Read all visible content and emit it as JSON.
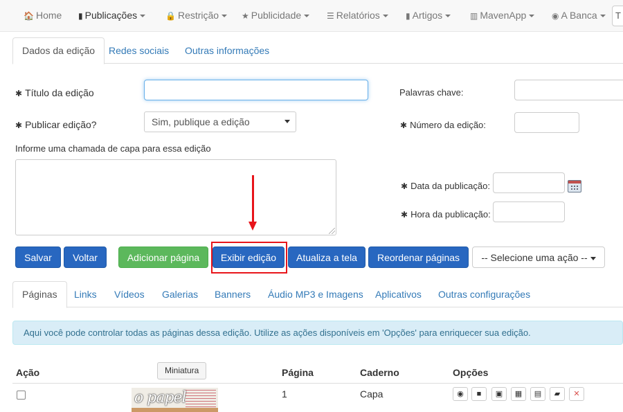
{
  "navbar": {
    "items": [
      {
        "label": "Home",
        "icon": "home-icon",
        "glyph": "🏠",
        "dropdown": false
      },
      {
        "label": "Publicações",
        "icon": "file-icon",
        "glyph": "▮",
        "dropdown": true
      },
      {
        "label": "Restrição",
        "icon": "lock-icon",
        "glyph": "🔒",
        "dropdown": true
      },
      {
        "label": "Publicidade",
        "icon": "star-icon",
        "glyph": "★",
        "dropdown": true
      },
      {
        "label": "Relatórios",
        "icon": "list-icon",
        "glyph": "☰",
        "dropdown": true
      },
      {
        "label": "Artigos",
        "icon": "bookmark-icon",
        "glyph": "▮",
        "dropdown": true
      },
      {
        "label": "MavenApp",
        "icon": "barcode-icon",
        "glyph": "▥",
        "dropdown": true
      },
      {
        "label": "A Banca",
        "icon": "globe-icon",
        "glyph": "◉",
        "dropdown": true
      }
    ],
    "end_partial": "T"
  },
  "top_tabs": [
    "Dados da edição",
    "Redes sociais",
    "Outras informações"
  ],
  "form": {
    "required_mark": "✱",
    "titulo_label": "Título da edição",
    "titulo_value": "",
    "publicar_label": "Publicar edição?",
    "publicar_value": "Sim, publique a edição",
    "chamada_label": "Informe uma chamada de capa para essa edição",
    "palavras_label": "Palavras chave:",
    "numero_label": "Número da edição:",
    "data_label": "Data da publicação:",
    "hora_label": "Hora da publicação:"
  },
  "actions": {
    "salvar": "Salvar",
    "voltar": "Voltar",
    "adicionar": "Adicionar página",
    "exibir": "Exibir edição",
    "atualiza": "Atualiza a tela",
    "reordenar": "Reordenar páginas",
    "acao_select": "-- Selecione uma ação --"
  },
  "sub_tabs": [
    "Páginas",
    "Links",
    "Vídeos",
    "Galerias",
    "Banners",
    "Áudio MP3 e Imagens",
    "Aplicativos",
    "Outras configurações"
  ],
  "alert": "Aqui você pode controlar todas as páginas dessa edição. Utilize as ações disponíveis em 'Opções' para enriquecer sua edição.",
  "table": {
    "headers": {
      "acao": "Ação",
      "miniatura": "Miniatura",
      "pagina": "Página",
      "caderno": "Caderno",
      "opcoes": "Opções"
    },
    "rows": [
      {
        "pagina": "1",
        "caderno": "Capa",
        "thumb_logo": "o papel"
      }
    ],
    "option_icons": [
      {
        "icon": "globe-icon",
        "glyph": "◉"
      },
      {
        "icon": "video-camera-icon",
        "glyph": "■"
      },
      {
        "icon": "picture-icon",
        "glyph": "▣"
      },
      {
        "icon": "grid-icon",
        "glyph": "▦"
      },
      {
        "icon": "window-icon",
        "glyph": "▤"
      },
      {
        "icon": "book-icon",
        "glyph": "▰"
      },
      {
        "icon": "delete-icon",
        "glyph": "✕"
      }
    ]
  }
}
